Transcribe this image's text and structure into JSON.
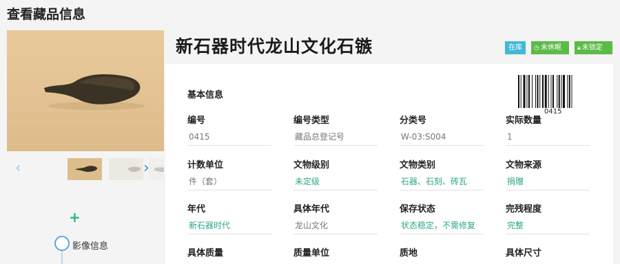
{
  "page": {
    "title": "查看藏品信息"
  },
  "item": {
    "title": "新石器时代龙山文化石镞",
    "badges": {
      "stock": "在库",
      "dormant": "未休眠",
      "lock": "未锁定"
    },
    "barcode_number": "0415"
  },
  "gallery": {
    "prev_icon": "chevron-left-icon",
    "next_icon": "chevron-right-icon"
  },
  "timeline": {
    "label": "影像信息"
  },
  "section": {
    "title": "基本信息"
  },
  "fields": [
    [
      {
        "label": "编号",
        "value": "0415",
        "link": false
      },
      {
        "label": "编号类型",
        "value": "藏品总登记号",
        "link": false
      },
      {
        "label": "分类号",
        "value": "W-03:S004",
        "link": false
      },
      {
        "label": "实际数量",
        "value": "1",
        "link": false
      }
    ],
    [
      {
        "label": "计数单位",
        "value": "件（套）",
        "link": false
      },
      {
        "label": "文物级别",
        "value": "未定级",
        "link": true
      },
      {
        "label": "文物类别",
        "value": "石器、石刻、砖瓦",
        "link": true
      },
      {
        "label": "文物来源",
        "value": "捐赠",
        "link": true
      }
    ],
    [
      {
        "label": "年代",
        "value": "新石器时代",
        "link": true
      },
      {
        "label": "具体年代",
        "value": "龙山文化",
        "link": false
      },
      {
        "label": "保存状态",
        "value": "状态稳定，不需修复",
        "link": true
      },
      {
        "label": "完残程度",
        "value": "完整",
        "link": true
      }
    ],
    [
      {
        "label": "具体质量",
        "value": "",
        "link": false
      },
      {
        "label": "质量单位",
        "value": "",
        "link": false
      },
      {
        "label": "质地",
        "value": "",
        "link": false
      },
      {
        "label": "具体尺寸",
        "value": "",
        "link": false
      }
    ]
  ]
}
